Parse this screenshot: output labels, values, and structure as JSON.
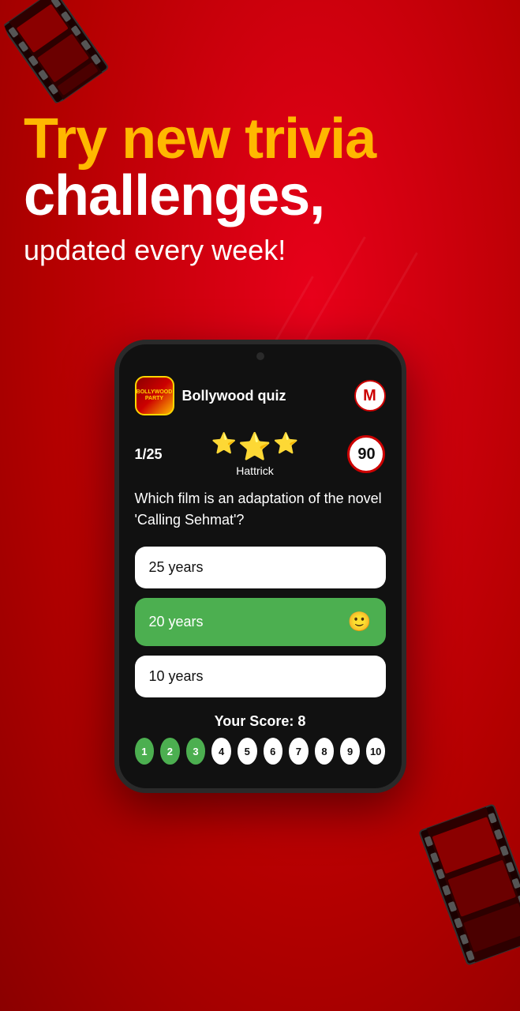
{
  "background": {
    "color": "#cc0000"
  },
  "header": {
    "line1": "Try new trivia",
    "line2": "challenges,",
    "line3": "updated every week!"
  },
  "phone": {
    "app": {
      "icon_text": "BOLLYWOOD\nPARTY",
      "title": "Bollywood quiz",
      "avatar": "M"
    },
    "quiz": {
      "question_number": "1/25",
      "streak_label": "Hattrick",
      "timer": "90",
      "question_text": "Which film is an adaptation of the novel 'Calling Sehmat'?",
      "options": [
        {
          "text": "25 years",
          "state": "default"
        },
        {
          "text": "20 years",
          "state": "correct"
        },
        {
          "text": "10 years",
          "state": "default"
        }
      ]
    },
    "score": {
      "label": "Your Score: 8"
    },
    "progress": {
      "dots": [
        {
          "number": "1",
          "state": "completed"
        },
        {
          "number": "2",
          "state": "completed"
        },
        {
          "number": "3",
          "state": "completed"
        },
        {
          "number": "4",
          "state": "inactive"
        },
        {
          "number": "5",
          "state": "inactive"
        },
        {
          "number": "6",
          "state": "inactive"
        },
        {
          "number": "7",
          "state": "inactive"
        },
        {
          "number": "8",
          "state": "inactive"
        },
        {
          "number": "9",
          "state": "inactive"
        },
        {
          "number": "10",
          "state": "inactive"
        }
      ]
    }
  }
}
